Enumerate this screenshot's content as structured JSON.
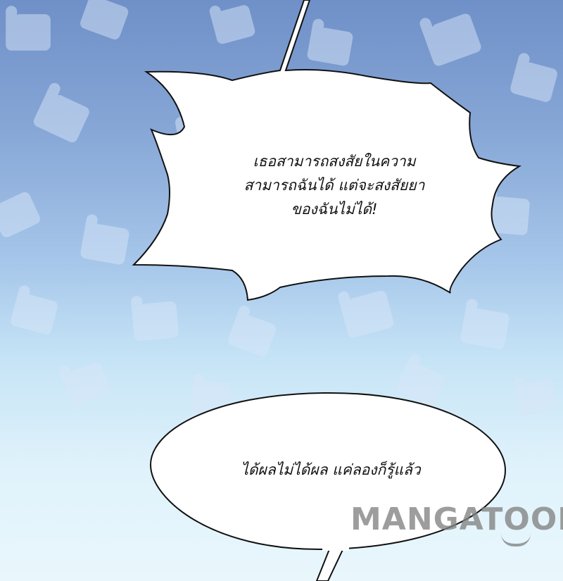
{
  "panel": {
    "speech_bubble_1": {
      "lines": [
        "เธอสามารถสงสัยในความ",
        "สามารถฉันได้ แต่จะสงสัยยา",
        "ของฉันไม่ได้!"
      ]
    },
    "speech_bubble_2": {
      "text": "ได้ผลไม่ได้ผล แค่ลองก็รู้แล้ว"
    },
    "watermark": {
      "text": "MANGATOON"
    }
  },
  "colors": {
    "sky_top": "#6f90c8",
    "sky_bottom": "#e9f7fc",
    "bubble_fill": "#ffffff",
    "bubble_outline": "#111111",
    "swirl": "#c9dcf2",
    "watermark": "#828282"
  }
}
